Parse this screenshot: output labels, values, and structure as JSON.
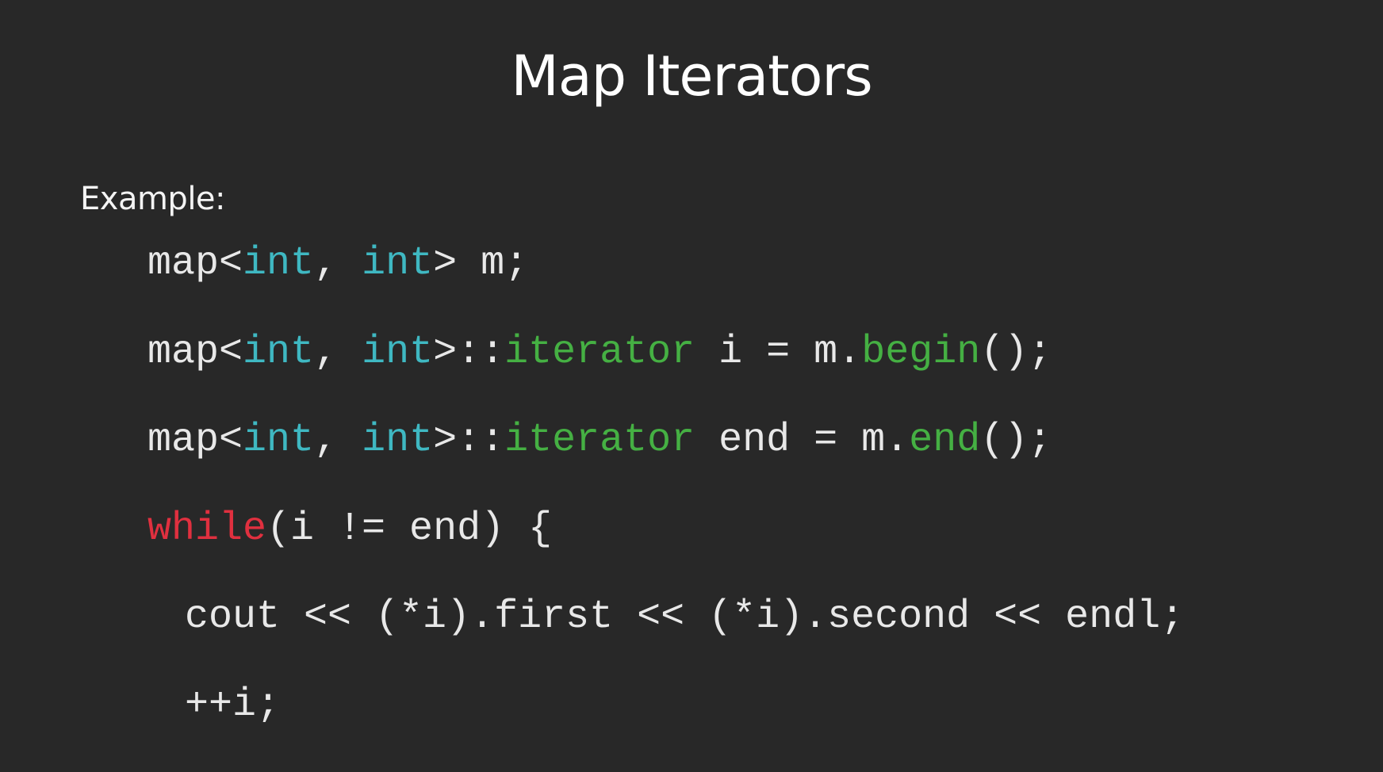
{
  "slide": {
    "title": "Map Iterators",
    "label": "Example:",
    "code_lines": [
      [
        {
          "text": "map<",
          "kind": "plain"
        },
        {
          "text": "int",
          "kind": "type"
        },
        {
          "text": ", ",
          "kind": "plain"
        },
        {
          "text": "int",
          "kind": "type"
        },
        {
          "text": "> m;",
          "kind": "plain"
        }
      ],
      [
        {
          "text": "map<",
          "kind": "plain"
        },
        {
          "text": "int",
          "kind": "type"
        },
        {
          "text": ", ",
          "kind": "plain"
        },
        {
          "text": "int",
          "kind": "type"
        },
        {
          "text": ">::",
          "kind": "plain"
        },
        {
          "text": "iterator",
          "kind": "fn"
        },
        {
          "text": " i = m.",
          "kind": "plain"
        },
        {
          "text": "begin",
          "kind": "fn"
        },
        {
          "text": "();",
          "kind": "plain"
        }
      ],
      [
        {
          "text": "map<",
          "kind": "plain"
        },
        {
          "text": "int",
          "kind": "type"
        },
        {
          "text": ", ",
          "kind": "plain"
        },
        {
          "text": "int",
          "kind": "type"
        },
        {
          "text": ">::",
          "kind": "plain"
        },
        {
          "text": "iterator",
          "kind": "fn"
        },
        {
          "text": " end = m.",
          "kind": "plain"
        },
        {
          "text": "end",
          "kind": "fn"
        },
        {
          "text": "();",
          "kind": "plain"
        }
      ],
      [
        {
          "text": "while",
          "kind": "kw"
        },
        {
          "text": "(i != end) {",
          "kind": "plain"
        }
      ],
      [
        {
          "text": "cout << (*i).first << (*i).second << endl;",
          "kind": "plain"
        }
      ],
      [
        {
          "text": "++i;",
          "kind": "plain"
        }
      ]
    ]
  },
  "colors": {
    "background": "#282828",
    "type": "#3fb8c2",
    "function": "#45b043",
    "keyword": "#e0303f",
    "text": "#e8e8e8"
  }
}
